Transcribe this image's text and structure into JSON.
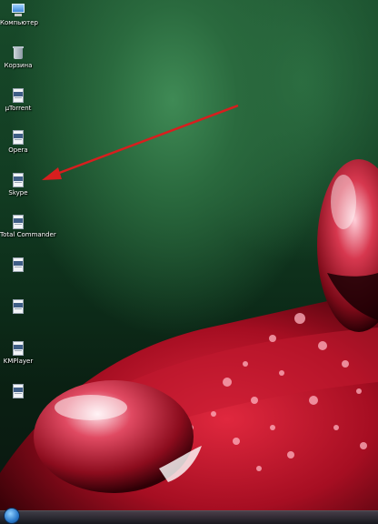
{
  "desktop": {
    "icons": [
      {
        "label": "Компьютер",
        "icon": "computer-icon"
      },
      {
        "label": "Корзина",
        "icon": "recycle-bin-icon"
      },
      {
        "label": "µTorrent",
        "icon": "generic-file-icon"
      },
      {
        "label": "Opera",
        "icon": "generic-file-icon"
      },
      {
        "label": "Skype",
        "icon": "generic-file-icon"
      },
      {
        "label": "Total Commander",
        "icon": "generic-file-icon"
      },
      {
        "label": "",
        "icon": "generic-file-icon"
      },
      {
        "label": "",
        "icon": "generic-file-icon"
      },
      {
        "label": "KMPlayer",
        "icon": "generic-file-icon"
      },
      {
        "label": "",
        "icon": "generic-file-icon"
      }
    ]
  },
  "annotation": {
    "color": "#d81e1e",
    "target": "Skype"
  },
  "taskbar": {
    "start_icon": "windows-orb-icon"
  }
}
